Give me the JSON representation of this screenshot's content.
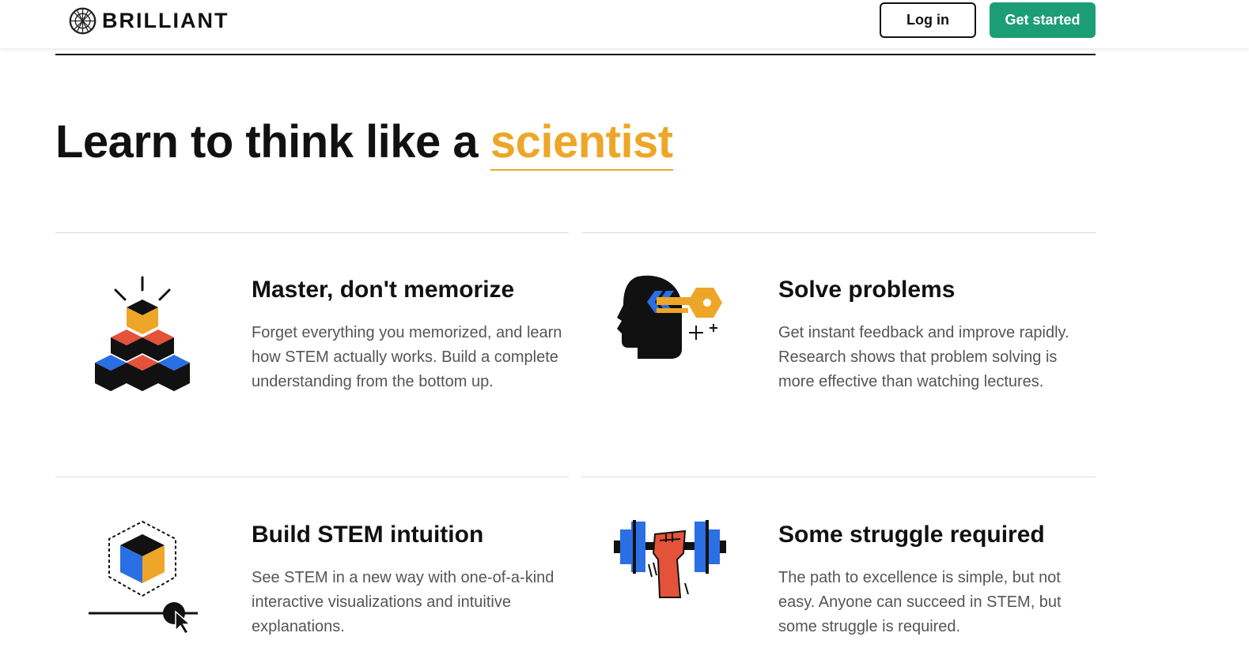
{
  "header": {
    "brand": "BRILLIANT",
    "login_label": "Log in",
    "start_label": "Get started"
  },
  "hero": {
    "headline_prefix": "Learn to think like a ",
    "headline_accent": "scientist",
    "accent_color": "#eea628"
  },
  "features": [
    {
      "title": "Master, don't memorize",
      "description": "Forget everything you memorized, and learn how STEM actually works. Build a complete understanding from the bottom up.",
      "icon": "stacked-cubes-icon"
    },
    {
      "title": "Solve problems",
      "description": "Get instant feedback and improve rapidly. Research shows that problem solving is more effective than watching lectures.",
      "icon": "head-with-key-icon"
    },
    {
      "title": "Build STEM intuition",
      "description": "See STEM in a new way with one-of-a-kind interactive visualizations and intuitive explanations.",
      "icon": "cube-slider-icon"
    },
    {
      "title": "Some struggle required",
      "description": "The path to excellence is simple, but not easy. Anyone can succeed in STEM, but some struggle is required.",
      "icon": "dumbbell-icon"
    }
  ],
  "colors": {
    "brand_green": "#1c9e74",
    "accent_yellow": "#eea628",
    "icon_blue": "#2a6fe3",
    "icon_red": "#e4523a"
  }
}
